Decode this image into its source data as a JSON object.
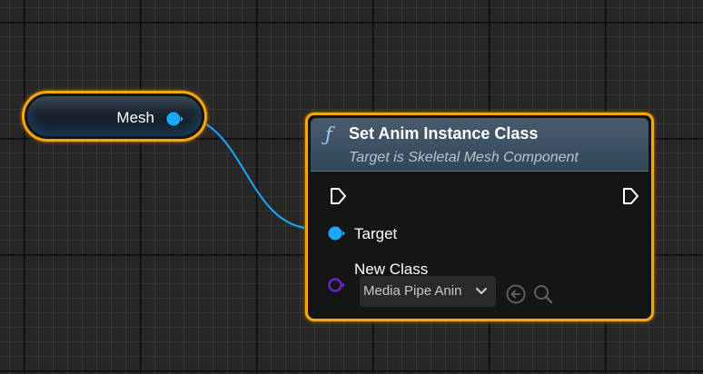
{
  "variable_node": {
    "label": "Mesh",
    "pin_color": "#1aa7ff",
    "border_color": "#f2a80f"
  },
  "function_node": {
    "icon": "function-icon",
    "icon_glyph": "ƒ",
    "title": "Set Anim Instance Class",
    "subtitle": "Target is Skeletal Mesh Component",
    "pins": {
      "exec_in": "exec-in-pin",
      "exec_out": "exec-out-pin",
      "target_label": "Target",
      "target_color": "#1aa7ff",
      "new_class_label": "New Class",
      "new_class_color": "#6a22c9"
    },
    "class_select": {
      "value": "Media Pipe Anin",
      "icon": "chevron-down-icon"
    },
    "buttons": {
      "use_selected": "arrow-left-circle-icon",
      "browse": "search-icon"
    }
  },
  "colors": {
    "wire": "#1aa7ff",
    "grid_background": "#262626",
    "node_selection": "#f2a80f"
  }
}
